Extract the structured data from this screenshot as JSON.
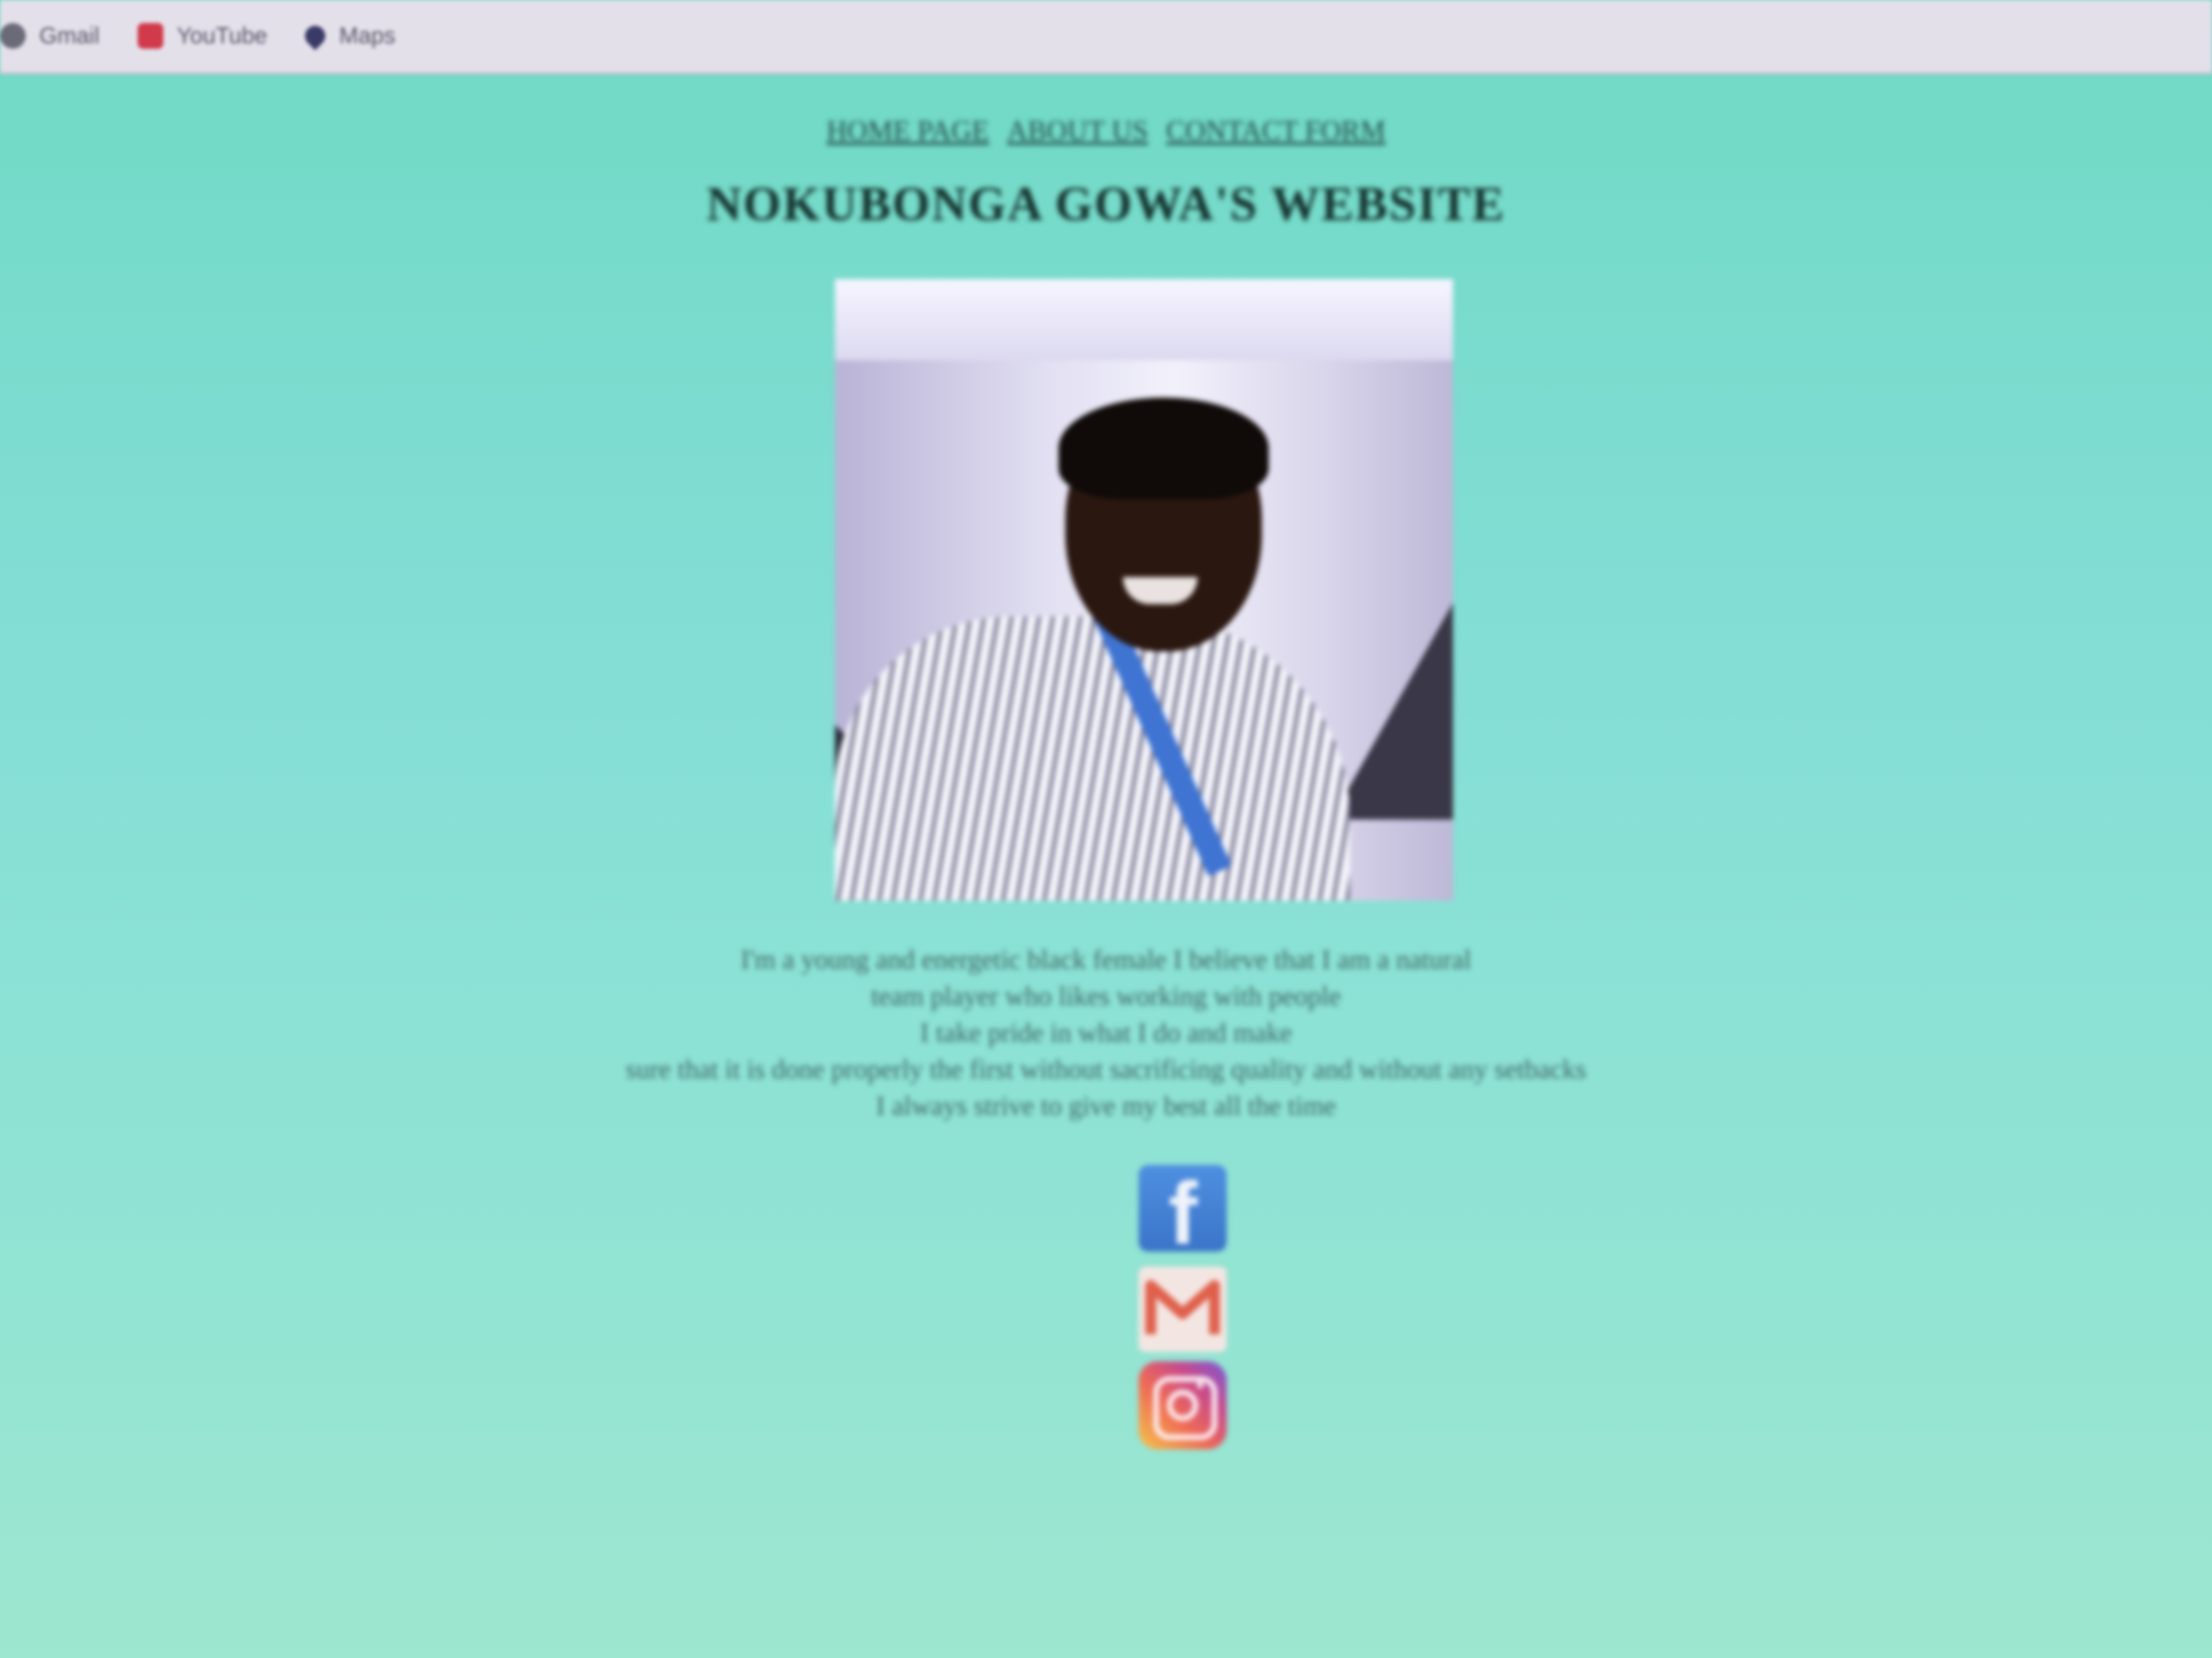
{
  "bookmarks": [
    {
      "label": "Gmail",
      "icon": "google-icon"
    },
    {
      "label": "YouTube",
      "icon": "youtube-icon"
    },
    {
      "label": "Maps",
      "icon": "maps-icon"
    }
  ],
  "nav": {
    "home": "HOME PAGE",
    "about": "ABOUT US",
    "contact": "CONTACT FORM"
  },
  "site_title": "NOKUBONGA GOWA'S WEBSITE",
  "bio_lines": [
    "I'm a young and energetic black female I believe that I am a natural",
    "team player who likes working with people",
    "I take pride in what I do and make",
    "sure that it is done properly the first without sacrificing quality and without any setbacks",
    "I always strive to give my best all the time"
  ],
  "social": {
    "facebook_glyph": "f",
    "icons": [
      "facebook-icon",
      "gmail-icon",
      "instagram-icon"
    ]
  },
  "colors": {
    "page_background": "#84ded6",
    "title": "#15332f",
    "nav_link": "#1f4a45",
    "bio_text": "#3d6663"
  }
}
